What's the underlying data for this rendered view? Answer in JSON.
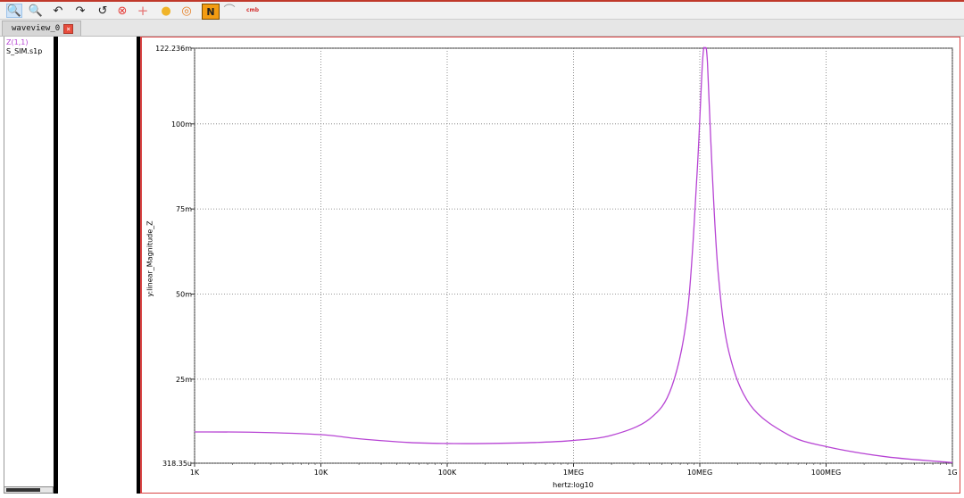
{
  "toolbar": {
    "items": [
      {
        "icon": "zoom-in-icon",
        "glyph": "🔍",
        "active": true
      },
      {
        "icon": "zoom-out-icon",
        "glyph": "🔍"
      },
      {
        "icon": "undo-icon",
        "glyph": "↶"
      },
      {
        "icon": "redo-icon",
        "glyph": "↷"
      },
      {
        "icon": "refresh-icon",
        "glyph": "↺"
      },
      {
        "icon": "delete-icon",
        "glyph": "⊗"
      },
      {
        "icon": "crosshair-icon",
        "glyph": "+"
      },
      {
        "icon": "marker-icon",
        "glyph": "●"
      },
      {
        "icon": "target-icon",
        "glyph": "◎"
      },
      {
        "icon": "n-icon",
        "glyph": "N"
      },
      {
        "icon": "waveform-icon",
        "glyph": "⌒"
      },
      {
        "icon": "cmb-icon",
        "glyph": "cmb"
      }
    ]
  },
  "tabs": [
    {
      "label": "waveview_0"
    }
  ],
  "signals": {
    "name": "Z(1,1)",
    "file": "S_SIM.s1p"
  },
  "colors": {
    "trace": "#b744d4"
  },
  "chart_data": {
    "type": "line",
    "xscale": "log10",
    "xlabel": "hertz:log10",
    "ylabel": "y:linear_Magnitude_Z",
    "xlim": [
      1000,
      1000000000
    ],
    "ylim": [
      0.000318,
      0.122236
    ],
    "x_ticks": [
      {
        "value": 1000,
        "label": "1K"
      },
      {
        "value": 10000,
        "label": "10K"
      },
      {
        "value": 100000,
        "label": "100K"
      },
      {
        "value": 1000000,
        "label": "1MEG"
      },
      {
        "value": 10000000,
        "label": "10MEG"
      },
      {
        "value": 100000000,
        "label": "100MEG"
      },
      {
        "value": 1000000000,
        "label": "1G"
      }
    ],
    "y_ticks": [
      {
        "value": 0.000318,
        "label": "318.35u"
      },
      {
        "value": 0.025,
        "label": "25m"
      },
      {
        "value": 0.05,
        "label": "50m"
      },
      {
        "value": 0.075,
        "label": "75m"
      },
      {
        "value": 0.1,
        "label": "100m"
      },
      {
        "value": 0.122236,
        "label": "122.236m"
      }
    ],
    "grid": true,
    "series": [
      {
        "name": "Z(1,1)",
        "x": [
          1000,
          3000,
          10000,
          20000,
          50000,
          100000,
          200000,
          500000,
          1000000,
          2000000,
          4000000,
          6000000,
          8000000,
          9500000,
          10500000,
          11000000,
          11500000,
          12500000,
          14000000,
          17000000,
          25000000,
          50000000,
          100000000,
          300000000,
          1000000000
        ],
        "y": [
          0.0095,
          0.0094,
          0.0087,
          0.0075,
          0.0064,
          0.0061,
          0.0061,
          0.0064,
          0.007,
          0.0085,
          0.0133,
          0.0228,
          0.045,
          0.085,
          0.118,
          0.1222,
          0.118,
          0.087,
          0.056,
          0.033,
          0.0175,
          0.0087,
          0.0052,
          0.0022,
          0.0005
        ]
      }
    ]
  }
}
